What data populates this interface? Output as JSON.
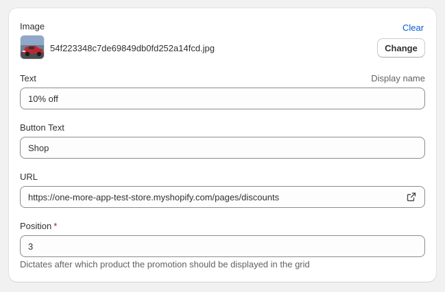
{
  "image_section": {
    "label": "Image",
    "clear_label": "Clear",
    "filename": "54f223348c7de69849db0fd252a14fcd.jpg",
    "change_label": "Change"
  },
  "text_field": {
    "label": "Text",
    "aside_label": "Display name",
    "value": "10% off"
  },
  "button_text_field": {
    "label": "Button Text",
    "value": "Shop"
  },
  "url_field": {
    "label": "URL",
    "value": "https://one-more-app-test-store.myshopify.com/pages/discounts",
    "icon": "external-link-icon"
  },
  "position_field": {
    "label": "Position",
    "required_mark": "*",
    "value": "3",
    "help_text": "Dictates after which product the promotion should be displayed in the grid"
  },
  "colors": {
    "link": "#005bd3",
    "required": "#8e1f0b",
    "border": "#8a8a8a"
  }
}
